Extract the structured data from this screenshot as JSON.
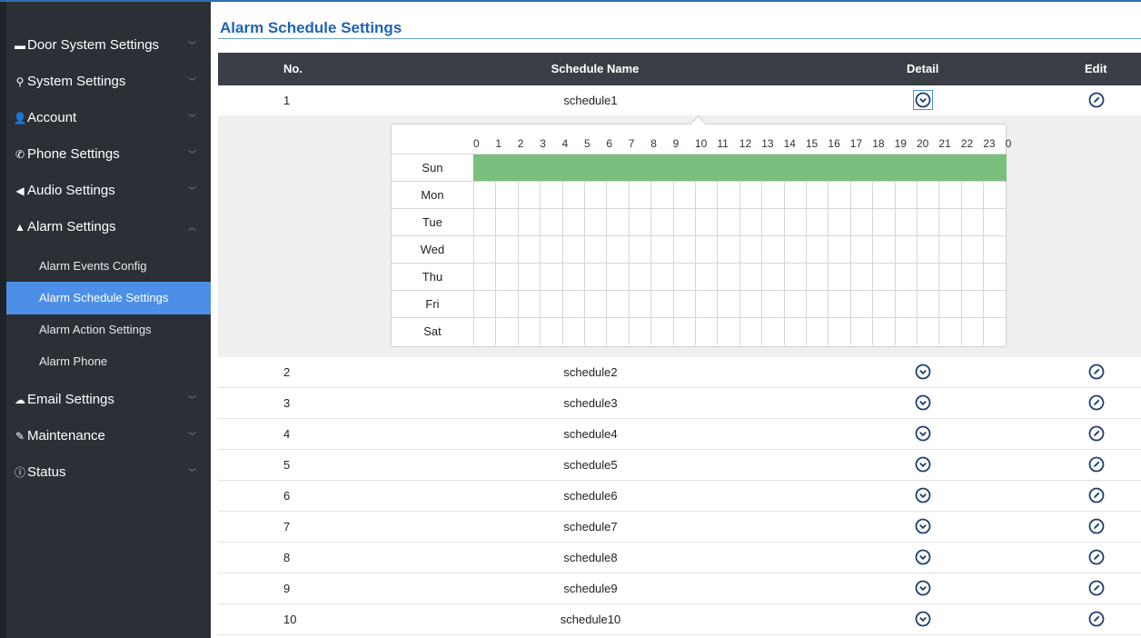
{
  "sidebar": {
    "items": [
      {
        "label": "Door System Settings",
        "icon": "card-icon",
        "glyph": "▬",
        "expanded": false
      },
      {
        "label": "System Settings",
        "icon": "wrench-key-icon",
        "glyph": "⚲",
        "expanded": false
      },
      {
        "label": "Account",
        "icon": "user-icon",
        "glyph": "👤",
        "expanded": false
      },
      {
        "label": "Phone Settings",
        "icon": "phone-icon",
        "glyph": "✆",
        "expanded": false
      },
      {
        "label": "Audio Settings",
        "icon": "speaker-icon",
        "glyph": "◀",
        "expanded": false
      },
      {
        "label": "Alarm Settings",
        "icon": "bell-icon",
        "glyph": "▲",
        "expanded": true
      },
      {
        "label": "Email Settings",
        "icon": "cloud-icon",
        "glyph": "☁",
        "expanded": false
      },
      {
        "label": "Maintenance",
        "icon": "wrench-icon",
        "glyph": "✎",
        "expanded": false
      },
      {
        "label": "Status",
        "icon": "info-icon",
        "glyph": "ⓘ",
        "expanded": false
      }
    ],
    "alarm_submenu": [
      {
        "label": "Alarm Events Config",
        "active": false
      },
      {
        "label": "Alarm Schedule Settings",
        "active": true
      },
      {
        "label": "Alarm Action Settings",
        "active": false
      },
      {
        "label": "Alarm Phone",
        "active": false
      }
    ]
  },
  "page": {
    "title": "Alarm Schedule Settings"
  },
  "table": {
    "headers": {
      "no": "No.",
      "name": "Schedule Name",
      "detail": "Detail",
      "edit": "Edit"
    },
    "rows": [
      {
        "no": "1",
        "name": "schedule1"
      },
      {
        "no": "2",
        "name": "schedule2"
      },
      {
        "no": "3",
        "name": "schedule3"
      },
      {
        "no": "4",
        "name": "schedule4"
      },
      {
        "no": "5",
        "name": "schedule5"
      },
      {
        "no": "6",
        "name": "schedule6"
      },
      {
        "no": "7",
        "name": "schedule7"
      },
      {
        "no": "8",
        "name": "schedule8"
      },
      {
        "no": "9",
        "name": "schedule9"
      },
      {
        "no": "10",
        "name": "schedule10"
      }
    ],
    "expanded_row": "1"
  },
  "schedule_detail": {
    "hours": [
      "0",
      "1",
      "2",
      "3",
      "4",
      "5",
      "6",
      "7",
      "8",
      "9",
      "10",
      "11",
      "12",
      "13",
      "14",
      "15",
      "16",
      "17",
      "18",
      "19",
      "20",
      "21",
      "22",
      "23",
      "0"
    ],
    "days": [
      {
        "name": "Sun",
        "active_hours": [
          0,
          1,
          2,
          3,
          4,
          5,
          6,
          7,
          8,
          9,
          10,
          11,
          12,
          13,
          14,
          15,
          16,
          17,
          18,
          19,
          20,
          21,
          22,
          23
        ]
      },
      {
        "name": "Mon",
        "active_hours": []
      },
      {
        "name": "Tue",
        "active_hours": []
      },
      {
        "name": "Wed",
        "active_hours": []
      },
      {
        "name": "Thu",
        "active_hours": []
      },
      {
        "name": "Fri",
        "active_hours": []
      },
      {
        "name": "Sat",
        "active_hours": []
      }
    ]
  },
  "colors": {
    "accent": "#1d63b6",
    "sidebar_bg": "#2b2f36",
    "active_item": "#4d8fe6",
    "table_header": "#3a3e46",
    "schedule_on": "#79c07e",
    "icon": "#1d3f73"
  }
}
